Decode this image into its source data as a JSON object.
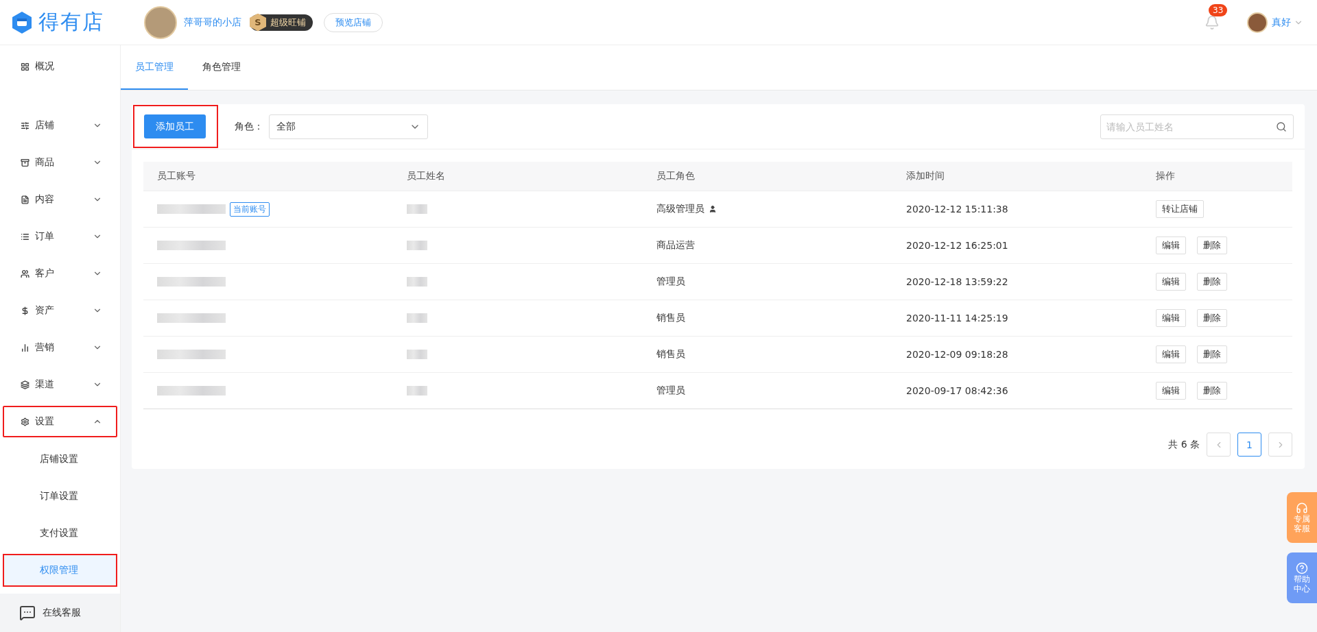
{
  "header": {
    "logo": "得有店",
    "shop_name": "萍哥哥的小店",
    "badge": "超级旺铺",
    "badge_letter": "S",
    "preview_button": "预览店铺",
    "notification_count": "33",
    "user_name": "真好"
  },
  "sidebar": {
    "items": [
      {
        "label": "概况",
        "expandable": false,
        "highlighted": false
      },
      {
        "label": "店铺",
        "expandable": true,
        "expanded": false,
        "highlighted": false
      },
      {
        "label": "商品",
        "expandable": true,
        "expanded": false,
        "highlighted": false
      },
      {
        "label": "内容",
        "expandable": true,
        "expanded": false,
        "highlighted": false
      },
      {
        "label": "订单",
        "expandable": true,
        "expanded": false,
        "highlighted": false
      },
      {
        "label": "客户",
        "expandable": true,
        "expanded": false,
        "highlighted": false
      },
      {
        "label": "资产",
        "expandable": true,
        "expanded": false,
        "highlighted": false
      },
      {
        "label": "营销",
        "expandable": true,
        "expanded": false,
        "highlighted": false
      },
      {
        "label": "渠道",
        "expandable": true,
        "expanded": false,
        "highlighted": false
      },
      {
        "label": "设置",
        "expandable": true,
        "expanded": true,
        "highlighted": true,
        "children": [
          {
            "label": "店铺设置",
            "selected": false,
            "highlighted": false
          },
          {
            "label": "订单设置",
            "selected": false,
            "highlighted": false
          },
          {
            "label": "支付设置",
            "selected": false,
            "highlighted": false
          },
          {
            "label": "权限管理",
            "selected": true,
            "highlighted": true
          }
        ]
      }
    ],
    "footer": "在线客服"
  },
  "tabs": [
    {
      "label": "员工管理",
      "selected": true
    },
    {
      "label": "角色管理",
      "selected": false
    }
  ],
  "toolbar": {
    "add_button": "添加员工",
    "add_highlighted": true,
    "role_label": "角色：",
    "role_value": "全部",
    "search": {
      "placeholder": "请输入员工姓名"
    }
  },
  "table": {
    "columns": [
      "员工账号",
      "员工姓名",
      "员工角色",
      "添加时间",
      "操作"
    ],
    "rows": [
      {
        "tag": "当前账号",
        "role": "高级管理员",
        "role_icon": true,
        "time": "2020-12-12 15:11:38",
        "actions": [
          "转让店铺"
        ]
      },
      {
        "role": "商品运营",
        "role_icon": false,
        "time": "2020-12-12 16:25:01",
        "actions": [
          "编辑",
          "删除"
        ]
      },
      {
        "role": "管理员",
        "role_icon": false,
        "time": "2020-12-18 13:59:22",
        "actions": [
          "编辑",
          "删除"
        ]
      },
      {
        "role": "销售员",
        "role_icon": false,
        "time": "2020-11-11 14:25:19",
        "actions": [
          "编辑",
          "删除"
        ]
      },
      {
        "role": "销售员",
        "role_icon": false,
        "time": "2020-12-09 09:18:28",
        "actions": [
          "编辑",
          "删除"
        ]
      },
      {
        "role": "管理员",
        "role_icon": false,
        "time": "2020-09-17 08:42:36",
        "actions": [
          "编辑",
          "删除"
        ]
      }
    ]
  },
  "pagination": {
    "total": "共 6 条",
    "pages": [
      {
        "label": "1",
        "selected": true
      }
    ]
  },
  "floating": [
    {
      "label": "专属客服",
      "kind": "service"
    },
    {
      "label": "帮助中心",
      "kind": "help"
    }
  ]
}
